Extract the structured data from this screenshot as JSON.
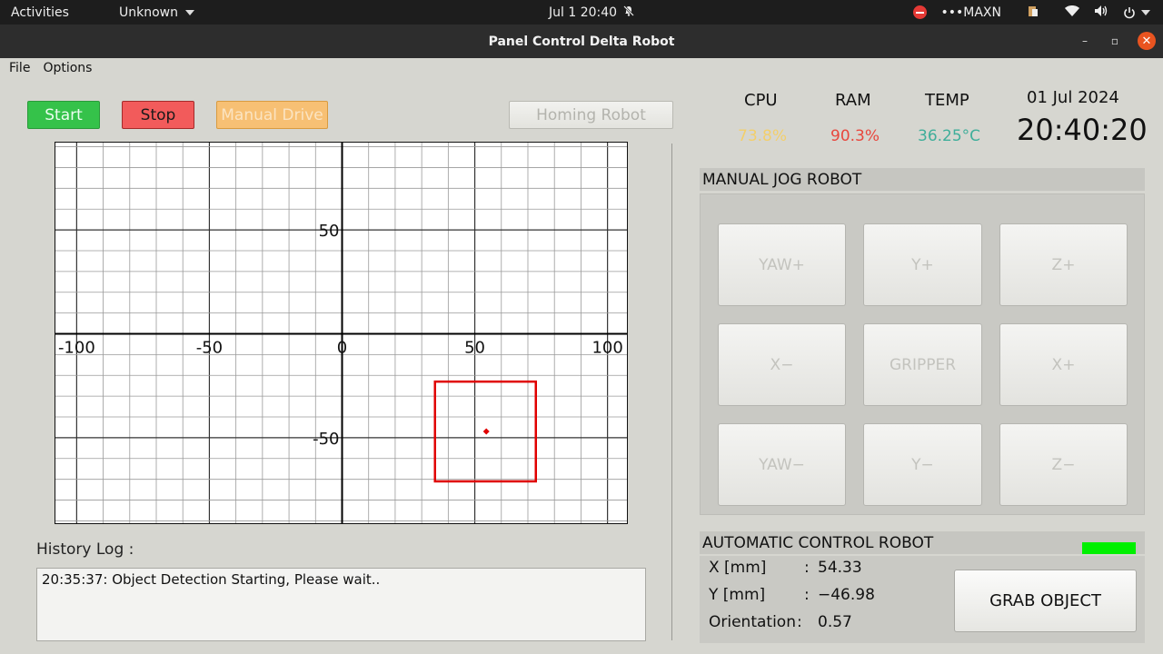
{
  "topbar": {
    "activities": "Activities",
    "workspace": "Unknown",
    "clock": "Jul 1  20:40",
    "power_mode": "•••MAXN"
  },
  "window": {
    "title": "Panel Control Delta Robot"
  },
  "menu": {
    "items": [
      "File",
      "Options"
    ]
  },
  "controls": {
    "start": "Start",
    "stop": "Stop",
    "manual_drive": "Manual Drive",
    "homing": "Homing Robot"
  },
  "plot": {
    "x_ticks": [
      "-100",
      "-50",
      "0",
      "50",
      "100"
    ],
    "y_ticks": [
      "50",
      "-50"
    ],
    "xlim": [
      -108,
      108
    ],
    "ylim": [
      -92,
      92
    ],
    "object_box": {
      "x_min": 35,
      "x_max": 73,
      "y_min": -71,
      "y_max": -23
    },
    "object_center": {
      "x": 54.33,
      "y": -46.98
    },
    "box_color": "#e00000"
  },
  "history": {
    "label": "History Log :",
    "entries": [
      "20:35:37: Object Detection Starting, Please wait.."
    ]
  },
  "stats": {
    "cpu_label": "CPU",
    "cpu_value": "73.8%",
    "cpu_color": "#f3cf6b",
    "ram_label": "RAM",
    "ram_value": "90.3%",
    "ram_color": "#e8473d",
    "temp_label": "TEMP",
    "temp_value": "36.25°C",
    "temp_color": "#3fae9a",
    "date": "01 Jul 2024",
    "time": "20:40:20"
  },
  "manual_jog": {
    "title": "MANUAL JOG ROBOT",
    "buttons": [
      "YAW+",
      "Y+",
      "Z+",
      "X−",
      "GRIPPER",
      "X+",
      "YAW−",
      "Y−",
      "Z−"
    ]
  },
  "auto": {
    "title": "AUTOMATIC CONTROL ROBOT",
    "status_color": "#00f000",
    "x_label": "X [mm]",
    "x_value": "54.33",
    "y_label": "Y [mm]",
    "y_value": "−46.98",
    "orient_label": "Orientation",
    "orient_value": "0.57",
    "grab_label": "GRAB OBJECT"
  }
}
